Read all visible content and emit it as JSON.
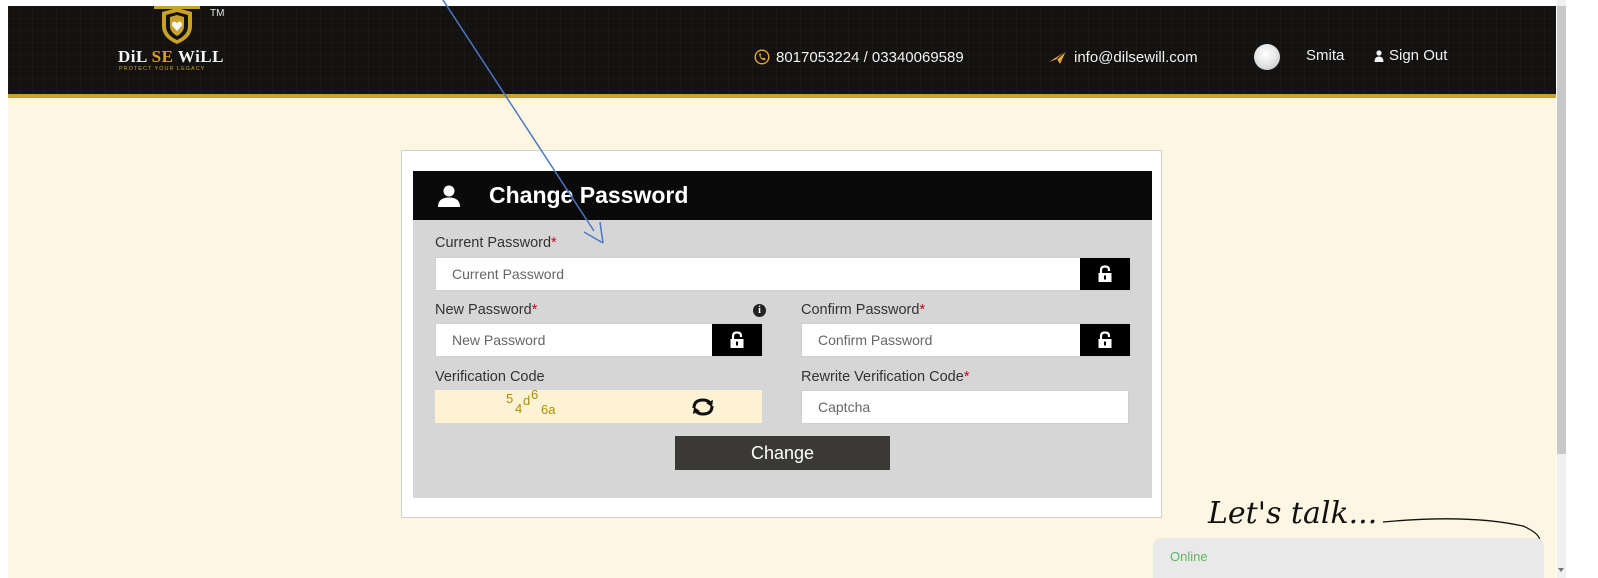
{
  "brand": {
    "name_part1": "DiL ",
    "name_part2": "SE",
    "name_part3": " WiLL",
    "tagline": "PROTECT YOUR LEGACY",
    "trademark": "TM"
  },
  "header": {
    "phone": "8017053224 / 03340069589",
    "email": "info@dilsewill.com",
    "user_name": "Smita",
    "sign_out": "Sign Out",
    "icons": {
      "phone": "phone-icon",
      "email": "paper-plane-icon",
      "user": "user-icon"
    },
    "colors": {
      "background": "#141210",
      "accent": "#c9a227"
    }
  },
  "form": {
    "title": "Change Password",
    "current_password": {
      "label": "Current Password",
      "required": "*",
      "placeholder": "Current Password"
    },
    "new_password": {
      "label": "New Password",
      "required": "*",
      "placeholder": "New Password"
    },
    "confirm_password": {
      "label": "Confirm Password",
      "required": "*",
      "placeholder": "Confirm Password"
    },
    "verification": {
      "label": "Verification Code",
      "chars": [
        "5",
        "4",
        "d",
        "6",
        "6a"
      ]
    },
    "rewrite": {
      "label": "Rewrite Verification Code",
      "required": "*",
      "placeholder": "Captcha"
    },
    "submit_label": "Change",
    "info_glyph": "i"
  },
  "chat": {
    "heading": "Let's talk...",
    "status": "Online"
  },
  "colors": {
    "page_bg": "#fdf6e3",
    "panel_bg": "#d6d6d6",
    "button_bg": "#3a3936",
    "required": "#d0021b",
    "online": "#5cb85c"
  }
}
